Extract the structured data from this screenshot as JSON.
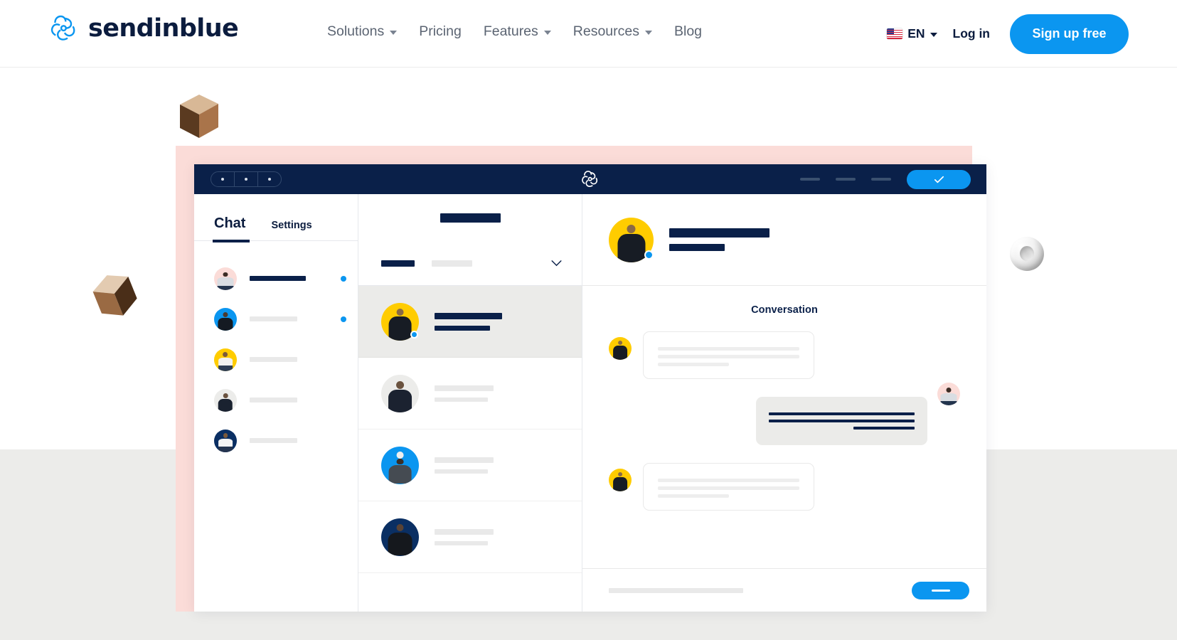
{
  "nav": {
    "brand": "sendinblue",
    "brand_icon": "sendinblue-flower-logo",
    "links": [
      {
        "label": "Solutions",
        "has_dropdown": true
      },
      {
        "label": "Pricing",
        "has_dropdown": false
      },
      {
        "label": "Features",
        "has_dropdown": true
      },
      {
        "label": "Resources",
        "has_dropdown": true
      },
      {
        "label": "Blog",
        "has_dropdown": false
      }
    ],
    "language": {
      "code": "EN",
      "flag": "us-flag-icon"
    },
    "login_label": "Log in",
    "signup_label": "Sign up free"
  },
  "colors": {
    "brand_blue": "#0b96f0",
    "navy": "#0a2049",
    "pink_backdrop": "#fbdcd8",
    "gray_band": "#ececea",
    "yellow_avatar": "#ffcc00",
    "selected_row": "#ebebe9"
  },
  "app": {
    "titlebar": {
      "window_dots": 3,
      "logo_icon": "sendinblue-flower-logo",
      "menu_dashes": 3,
      "confirm_icon": "check-icon"
    },
    "tabs": [
      {
        "label": "Chat",
        "active": true
      },
      {
        "label": "Settings",
        "active": false
      }
    ],
    "contacts": [
      {
        "avatar_bg": "#fbdcd8",
        "unread": true,
        "name_filled": true
      },
      {
        "avatar_bg": "#0b96f0",
        "unread": true,
        "name_filled": false
      },
      {
        "avatar_bg": "#ffcc00",
        "unread": false,
        "name_filled": false
      },
      {
        "avatar_bg": "#ececea",
        "unread": false,
        "name_filled": false
      },
      {
        "avatar_bg": "#0a2f63",
        "unread": false,
        "name_filled": false
      }
    ],
    "conversation_list": [
      {
        "avatar_bg": "#ffcc00",
        "selected": true,
        "online": true
      },
      {
        "avatar_bg": "#ececea",
        "selected": false,
        "online": false
      },
      {
        "avatar_bg": "#0b96f0",
        "selected": false,
        "online": false
      },
      {
        "avatar_bg": "#0a2f63",
        "selected": false,
        "online": false
      }
    ],
    "conversation": {
      "header_avatar_bg": "#ffcc00",
      "header_online": true,
      "title": "Conversation",
      "messages": [
        {
          "direction": "in",
          "avatar_bg": "#ffcc00",
          "lines": 3
        },
        {
          "direction": "out",
          "avatar_bg": "#fbdcd8",
          "lines": 3
        },
        {
          "direction": "in",
          "avatar_bg": "#ffcc00",
          "lines": 3
        }
      ],
      "composer": {
        "send_icon": "send-dash-icon"
      }
    }
  },
  "decor": {
    "cube_top": "wooden-cube",
    "cube_left": "wooden-cube",
    "sphere_right": "glass-torus"
  }
}
